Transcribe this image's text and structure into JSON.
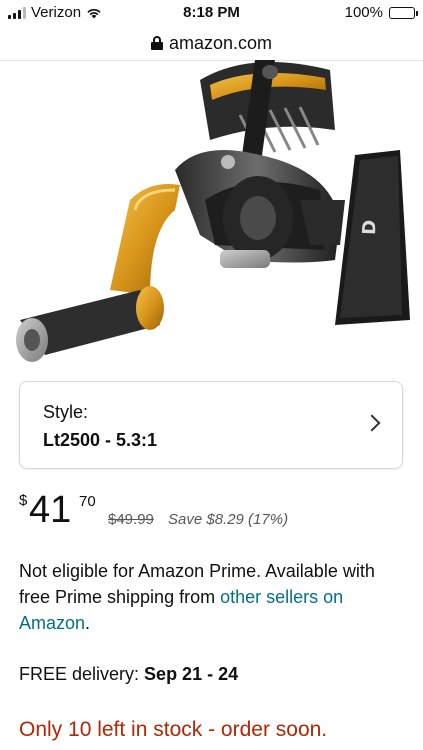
{
  "status_bar": {
    "carrier": "Verizon",
    "time": "8:18 PM",
    "battery": "100%"
  },
  "browser": {
    "url": "amazon.com"
  },
  "product": {
    "image_icon": "fishing-reel-image",
    "brand_mark": "D"
  },
  "style": {
    "label": "Style:",
    "value": "Lt2500 - 5.3:1"
  },
  "price": {
    "currency_symbol": "$",
    "whole": "41",
    "fraction": "70",
    "list_price": "$49.99",
    "savings": "Save $8.29 (17%)"
  },
  "shipping": {
    "prime_text": "Not eligible for Amazon Prime. Available with free Prime shipping from ",
    "other_sellers_link": "other sellers on Amazon",
    "prime_text_end": ".",
    "delivery_label": "FREE delivery: ",
    "delivery_dates": "Sep 21 - 24"
  },
  "stock": {
    "message": "Only 10 left in stock - order soon."
  },
  "colors": {
    "link": "#007185",
    "stock_alert": "#b12704",
    "reel_gold": "#e0a21e"
  }
}
